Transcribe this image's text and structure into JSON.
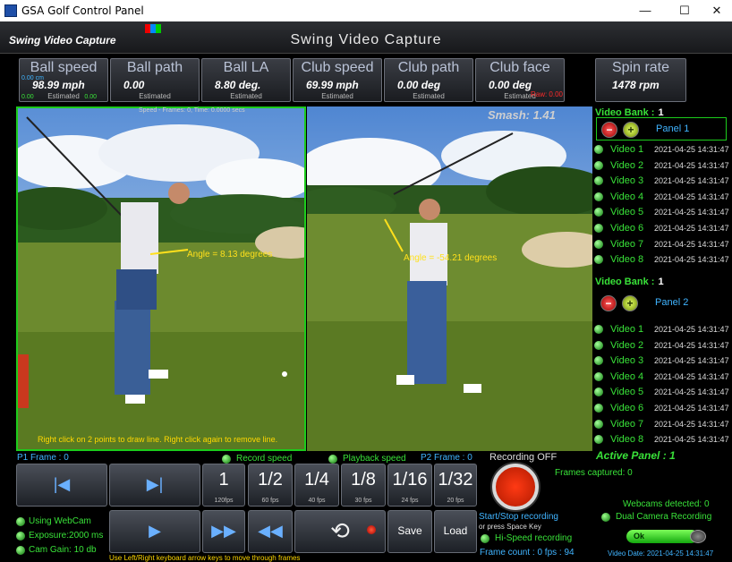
{
  "window": {
    "title": "GSA Golf Control Panel",
    "minimize": "—",
    "maximize": "☐",
    "close": "✕"
  },
  "header": {
    "left_title": "Swing Video Capture",
    "center_title": "Swing Video Capture"
  },
  "stats": [
    {
      "label": "Ball speed",
      "value": "98.99 mph",
      "note": "Estimated",
      "extra_top": "0.00 cm",
      "extra_bl": "0.00",
      "extra_br": "0.00"
    },
    {
      "label": "Ball path",
      "value": "0.00",
      "note": "Estimated"
    },
    {
      "label": "Ball LA",
      "value": "8.80 deg.",
      "note": "Estimated"
    },
    {
      "label": "Club speed",
      "value": "69.99 mph",
      "note": "Estimated"
    },
    {
      "label": "Club path",
      "value": "0.00 deg",
      "note": "Estimated"
    },
    {
      "label": "Club face",
      "value": "0.00 deg",
      "note": "Estimated",
      "raw": "Raw: 0.00"
    },
    {
      "label": "Spin rate",
      "value": "1478 rpm"
    }
  ],
  "video": {
    "frames_info": "Speed - Frames: 0, Time: 0.0000 secs",
    "smash": "Smash: 1.41",
    "angle_left": "Angle = 8.13 degrees",
    "angle_right": "Angle = -54.21 degrees",
    "hint": "Right click on 2 points to draw line. Right click again to remove line."
  },
  "banks": [
    {
      "title": "Video Bank :",
      "number": "1",
      "panel": "Panel 1",
      "videos": [
        {
          "name": "Video 1",
          "date": "2021-04-25 14:31:47"
        },
        {
          "name": "Video 2",
          "date": "2021-04-25 14:31:47"
        },
        {
          "name": "Video 3",
          "date": "2021-04-25 14:31:47"
        },
        {
          "name": "Video 4",
          "date": "2021-04-25 14:31:47"
        },
        {
          "name": "Video 5",
          "date": "2021-04-25 14:31:47"
        },
        {
          "name": "Video 6",
          "date": "2021-04-25 14:31:47"
        },
        {
          "name": "Video 7",
          "date": "2021-04-25 14:31:47"
        },
        {
          "name": "Video 8",
          "date": "2021-04-25 14:31:47"
        }
      ]
    },
    {
      "title": "Video Bank :",
      "number": "1",
      "panel": "Panel 2",
      "videos": [
        {
          "name": "Video 1",
          "date": "2021-04-25 14:31:47"
        },
        {
          "name": "Video 2",
          "date": "2021-04-25 14:31:47"
        },
        {
          "name": "Video 3",
          "date": "2021-04-25 14:31:47"
        },
        {
          "name": "Video 4",
          "date": "2021-04-25 14:31:47"
        },
        {
          "name": "Video 5",
          "date": "2021-04-25 14:31:47"
        },
        {
          "name": "Video 6",
          "date": "2021-04-25 14:31:47"
        },
        {
          "name": "Video 7",
          "date": "2021-04-25 14:31:47"
        },
        {
          "name": "Video 8",
          "date": "2021-04-25 14:31:47"
        }
      ]
    }
  ],
  "active_panel": "Active Panel : 1",
  "controls": {
    "p1_frame": "P1 Frame : 0",
    "p2_frame": "P2 Frame : 0",
    "record_speed": "Record speed",
    "playback_speed": "Playback speed",
    "recording_status": "Recording OFF",
    "frames_captured": "Frames captured: 0",
    "speeds": [
      {
        "label": "1",
        "fps": "120fps"
      },
      {
        "label": "1/2",
        "fps": "60 fps"
      },
      {
        "label": "1/4",
        "fps": "40 fps"
      },
      {
        "label": "1/8",
        "fps": "30 fps"
      },
      {
        "label": "1/16",
        "fps": "24 fps"
      },
      {
        "label": "1/32",
        "fps": "20 fps"
      }
    ],
    "save": "Save",
    "load": "Load",
    "using_webcam": "Using WebCam",
    "exposure": "Exposure:2000 ms",
    "cam_gain": "Cam Gain: 10 db",
    "keyboard_hint": "Use Left/Right keyboard arrow keys to move through frames",
    "start_stop": "Start/Stop recording",
    "space_key": "or press Space Key",
    "hispeed": "Hi-Speed recording",
    "frame_count": "Frame count : 0 fps : 94",
    "webcams": "Webcams detected: 0",
    "dual_camera": "Dual Camera Recording",
    "ok": "Ok",
    "video_date": "Video Date: 2021-04-25 14:31:47"
  },
  "colors": {
    "accent_green": "#39e239",
    "panel_blue": "#40b4ff",
    "record_red": "#e02a00"
  }
}
